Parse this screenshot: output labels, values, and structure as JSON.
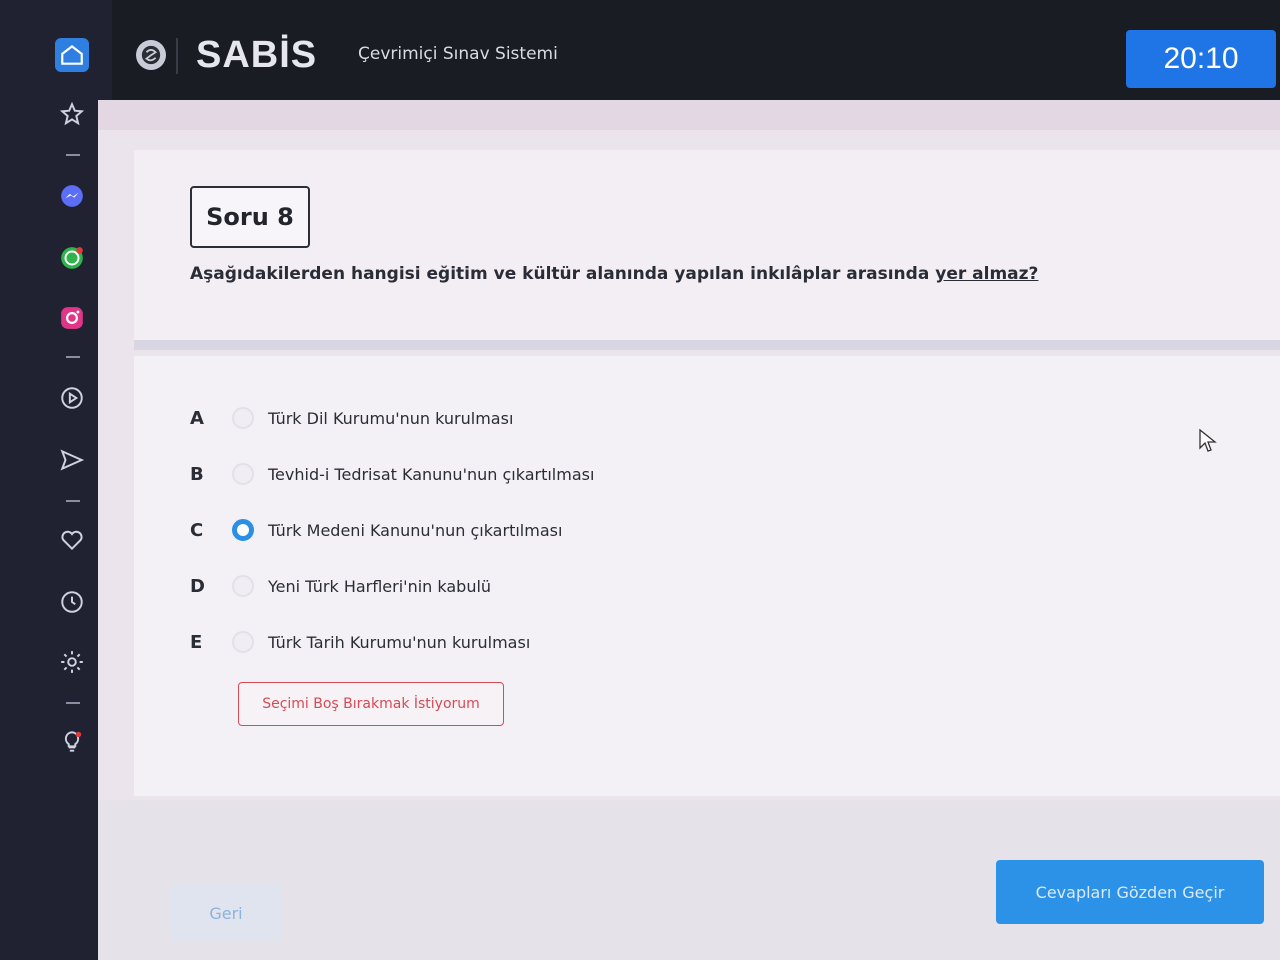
{
  "header": {
    "brand": "SABİS",
    "app_title": "Çevrimiçi Sınav Sistemi",
    "timer": "20:10"
  },
  "sidebar": {
    "icons": [
      "home-icon",
      "star-icon",
      "messenger-icon",
      "whatsapp-icon",
      "instagram-icon",
      "play-icon",
      "send-icon",
      "heart-icon",
      "clock-icon",
      "gear-icon",
      "lightbulb-icon"
    ]
  },
  "question": {
    "label": "Soru 8",
    "text_before": "Aşağıdakilerden hangisi eğitim ve kültür alanında yapılan inkılâplar arasında ",
    "text_underlined": "yer almaz?"
  },
  "options": [
    {
      "letter": "A",
      "text": "Türk Dil Kurumu'nun kurulması",
      "selected": false
    },
    {
      "letter": "B",
      "text": "Tevhid-i Tedrisat Kanunu'nun çıkartılması",
      "selected": false
    },
    {
      "letter": "C",
      "text": "Türk Medeni Kanunu'nun çıkartılması",
      "selected": true
    },
    {
      "letter": "D",
      "text": "Yeni Türk Harfleri'nin kabulü",
      "selected": false
    },
    {
      "letter": "E",
      "text": "Türk Tarih Kurumu'nun kurulması",
      "selected": false
    }
  ],
  "actions": {
    "leave_blank": "Seçimi Boş Bırakmak İstiyorum",
    "back": "Geri",
    "review": "Cevapları Gözden Geçir"
  },
  "colors": {
    "accent": "#1f74e6",
    "danger": "#d74a56"
  }
}
